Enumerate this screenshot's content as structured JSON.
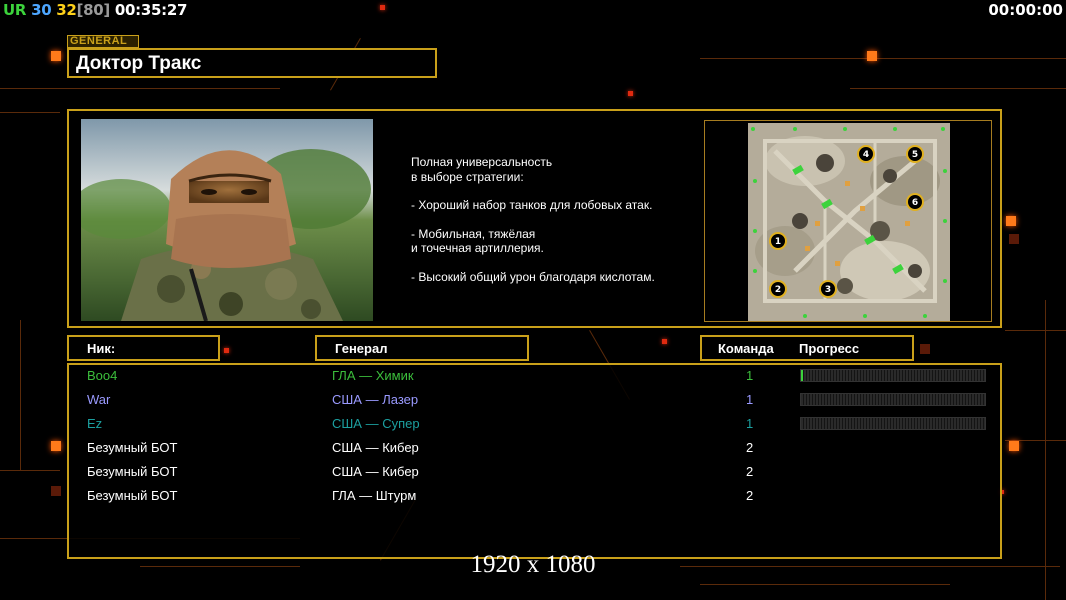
{
  "hud": {
    "ur_label": "UR",
    "ur_value": "30",
    "fps": "32",
    "fps_cap": "[80]",
    "clock": "00:35:27",
    "game_timer": "00:00:00"
  },
  "general": {
    "tag": "GENERAL",
    "name": "Доктор Тракс",
    "description": [
      "Полная универсальность\nв выборе стратегии:",
      "- Хороший набор танков для лобовых атак.",
      "- Мобильная, тяжёлая\nи точечная артиллерия.",
      "- Высокий общий урон благодаря кислотам."
    ]
  },
  "map": {
    "start_positions": [
      "1",
      "2",
      "3",
      "4",
      "5",
      "6"
    ]
  },
  "table": {
    "headers": {
      "nick": "Ник:",
      "general": "Генерал",
      "team": "Команда",
      "progress": "Прогресс"
    },
    "players": [
      {
        "nick": "Boo4",
        "general": "ГЛА — Химик",
        "team": "1",
        "color": "#3cbe3c",
        "progress": 0.01
      },
      {
        "nick": "War",
        "general": "США — Лазер",
        "team": "1",
        "color": "#9a9aff",
        "progress": 0
      },
      {
        "nick": "Ez",
        "general": "США — Супер",
        "team": "1",
        "color": "#1ca0a0",
        "progress": 0
      },
      {
        "nick": "Безумный БОТ",
        "general": "США — Кибер",
        "team": "2",
        "color": "#ffffff",
        "progress": null
      },
      {
        "nick": "Безумный БОТ",
        "general": "США — Кибер",
        "team": "2",
        "color": "#ffffff",
        "progress": null
      },
      {
        "nick": "Безумный БОТ",
        "general": "ГЛА — Штурм",
        "team": "2",
        "color": "#ffffff",
        "progress": null
      }
    ]
  },
  "resolution_text": "1920 x 1080",
  "colors": {
    "frame_gold": "#c9a01a",
    "accent_orange": "#ff7a1a"
  }
}
